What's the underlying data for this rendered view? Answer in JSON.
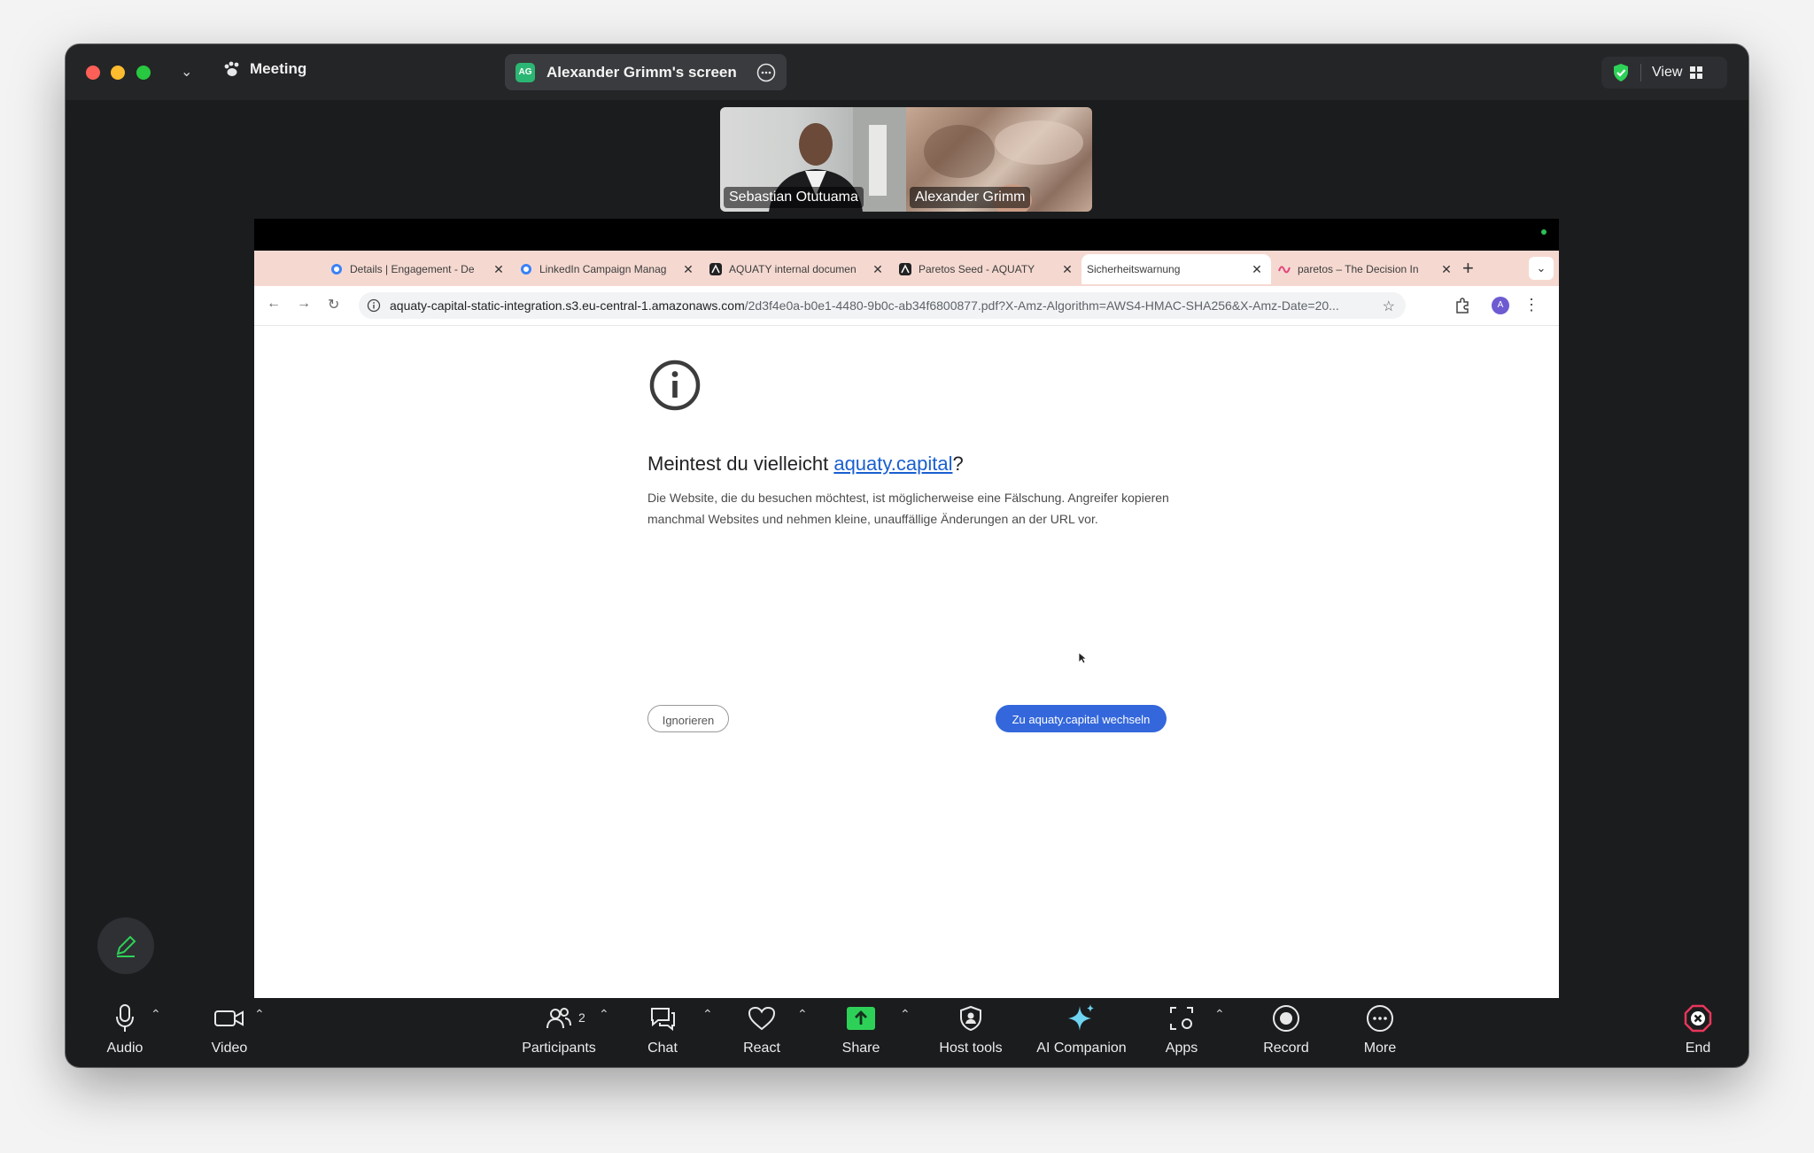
{
  "meeting": {
    "title": "Meeting",
    "share_label": "Alexander Grimm's screen",
    "share_badge": "AG",
    "view_label": "View"
  },
  "participants_strip": [
    {
      "name": "Sebastian Otutuama"
    },
    {
      "name": "Alexander Grimm"
    }
  ],
  "browser": {
    "tabs": [
      {
        "title": "Details | Engagement - De",
        "favicon": "globe-icon",
        "active": false
      },
      {
        "title": "LinkedIn Campaign Manag",
        "favicon": "globe-icon",
        "active": false
      },
      {
        "title": "AQUATY internal documen",
        "favicon": "aquaty-icon",
        "active": false
      },
      {
        "title": "Paretos Seed - AQUATY",
        "favicon": "aquaty-icon",
        "active": false
      },
      {
        "title": "Sicherheitswarnung",
        "favicon": "",
        "active": true
      },
      {
        "title": "paretos – The Decision In",
        "favicon": "paretos-icon",
        "active": false
      }
    ],
    "url_host": "aquaty-capital-static-integration.s3.eu-central-1.amazonaws.com",
    "url_path": "/2d3f4e0a-b0e1-4480-9b0c-ab34f6800877.pdf?X-Amz-Algorithm=AWS4-HMAC-SHA256&X-Amz-Date=20...",
    "profile_initial": "A"
  },
  "warning": {
    "title_prefix": "Meintest du vielleicht ",
    "title_link": "aquaty.capital",
    "title_suffix": "?",
    "body": "Die Website, die du besuchen möchtest, ist möglicherweise eine Fälschung. Angreifer kopieren manchmal Websites und nehmen kleine, unauffällige Änderungen an der URL vor.",
    "ignore_label": "Ignorieren",
    "go_label": "Zu aquaty.capital wechseln"
  },
  "controls": {
    "audio": "Audio",
    "video": "Video",
    "participants": "Participants",
    "participants_count": "2",
    "chat": "Chat",
    "react": "React",
    "share": "Share",
    "host_tools": "Host tools",
    "ai_companion": "AI Companion",
    "apps": "Apps",
    "record": "Record",
    "more": "More",
    "end": "End"
  },
  "colors": {
    "window_bg": "#1b1c1e",
    "share_green": "#2ed158",
    "end_red": "#e8365a",
    "link_blue": "#1a5fd0",
    "button_blue": "#3467db",
    "tabbar_bg": "#f5d9d1"
  }
}
